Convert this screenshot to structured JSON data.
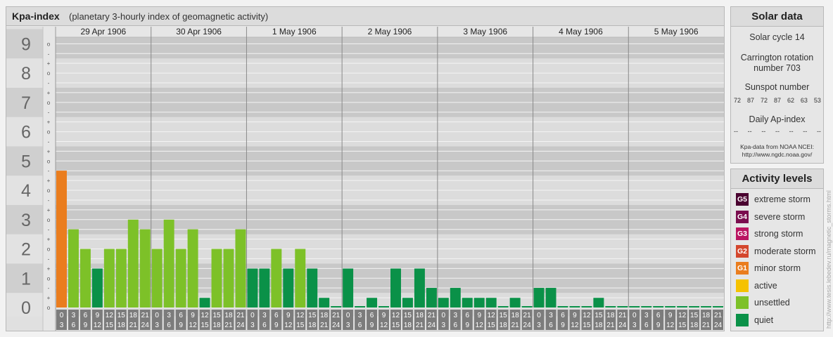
{
  "header": {
    "title": "Kpa-index",
    "subtitle": "(planetary 3-hourly index of geomagnetic activity)"
  },
  "chart_data": {
    "type": "bar",
    "title": "Kpa-index",
    "subtitle": "(planetary 3-hourly index of geomagnetic activity)",
    "ylim": [
      0,
      9
    ],
    "y_ticks": [
      "0",
      "1",
      "2",
      "3",
      "4",
      "5",
      "6",
      "7",
      "8",
      "9"
    ],
    "minor_ticks": [
      "o",
      "+",
      "-"
    ],
    "days": [
      "29 Apr 1906",
      "30 Apr 1906",
      "1 May 1906",
      "2 May 1906",
      "3 May 1906",
      "4 May 1906",
      "5 May 1906"
    ],
    "interval_start": [
      "0",
      "3",
      "6",
      "9",
      "12",
      "15",
      "18",
      "21"
    ],
    "interval_end": [
      "3",
      "6",
      "9",
      "12",
      "15",
      "18",
      "21",
      "24"
    ],
    "values": [
      [
        4.67,
        2.67,
        2.0,
        1.33,
        2.0,
        2.0,
        3.0,
        2.67
      ],
      [
        2.0,
        3.0,
        2.0,
        2.67,
        0.33,
        2.0,
        2.0,
        2.67
      ],
      [
        1.33,
        1.33,
        2.0,
        1.33,
        2.0,
        1.33,
        0.33,
        0.0
      ],
      [
        1.33,
        0.0,
        0.33,
        0.0,
        1.33,
        0.33,
        1.33,
        0.67
      ],
      [
        0.33,
        0.67,
        0.33,
        0.33,
        0.33,
        0.0,
        0.33,
        0.0
      ],
      [
        0.67,
        0.67,
        0.0,
        0.0,
        0.0,
        0.33,
        0.0,
        0.0
      ],
      [
        0.0,
        0.0,
        0.0,
        0.0,
        0.0,
        0.0,
        0.0,
        0.0
      ]
    ],
    "colors": {
      "quiet": "#0a9148",
      "unsettled": "#7dc128",
      "active": "#f5c200",
      "minor_storm": "#ea7d1e",
      "moderate_storm": "#d4472d",
      "strong_storm": "#ba1561",
      "severe_storm": "#7a0d4e",
      "extreme_storm": "#4a0330",
      "band_dark": "#c8c8c8",
      "band_light": "#dcdcdc",
      "axis_bg": "#7c7c7c",
      "minor_line": "#f4f4f4",
      "day_line": "#8a8a8a"
    }
  },
  "solar": {
    "title": "Solar data",
    "cycle": "Solar cycle 14",
    "carrington_line1": "Carrington rotation",
    "carrington_line2": "number 703",
    "sunspot_title": "Sunspot number",
    "sunspots": [
      "72",
      "87",
      "72",
      "87",
      "62",
      "63",
      "53"
    ],
    "ap_title": "Daily Ap-index",
    "ap_values": [
      "--",
      "--",
      "--",
      "--",
      "--",
      "--",
      "--"
    ],
    "note_line1": "Kpa-data from NOAA NCEI:",
    "note_line2": "http://www.ngdc.noaa.gov/"
  },
  "levels": {
    "title": "Activity levels",
    "items": [
      {
        "code": "G5",
        "label": "extreme storm",
        "color": "#4a0330"
      },
      {
        "code": "G4",
        "label": "severe storm",
        "color": "#7a0d4e"
      },
      {
        "code": "G3",
        "label": "strong storm",
        "color": "#ba1561"
      },
      {
        "code": "G2",
        "label": "moderate storm",
        "color": "#d4472d"
      },
      {
        "code": "G1",
        "label": "minor storm",
        "color": "#ea7d1e"
      },
      {
        "code": "",
        "label": "active",
        "color": "#f5c200"
      },
      {
        "code": "",
        "label": "unsettled",
        "color": "#7dc128"
      },
      {
        "code": "",
        "label": "quiet",
        "color": "#0a9148"
      }
    ]
  },
  "watermark": "http://www.tesis.lebedev.ru/magnetic_storms.html"
}
